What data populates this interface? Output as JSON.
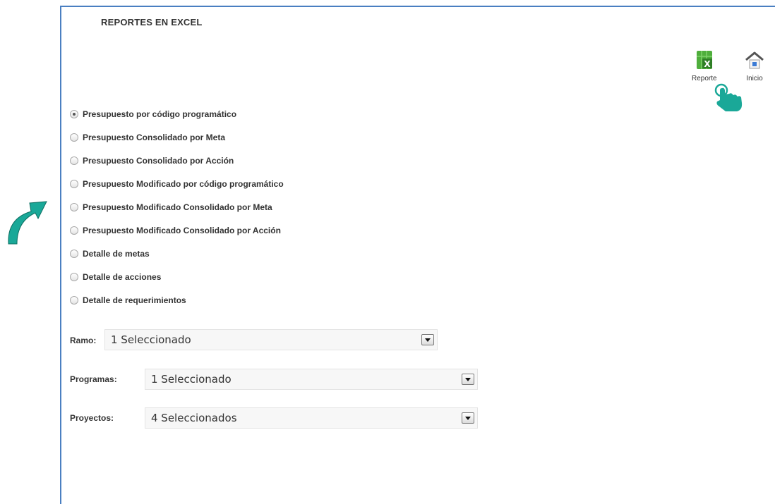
{
  "header": {
    "title": "REPORTES EN EXCEL"
  },
  "toolbar": {
    "reporte": {
      "label": "Reporte",
      "icon": "excel-icon"
    },
    "inicio": {
      "label": "Inicio",
      "icon": "home-icon"
    }
  },
  "report_options": [
    {
      "label": "Presupuesto por código programático",
      "checked": true
    },
    {
      "label": "Presupuesto Consolidado por Meta",
      "checked": false
    },
    {
      "label": "Presupuesto Consolidado por Acción",
      "checked": false
    },
    {
      "label": "Presupuesto Modificado por código programático",
      "checked": false
    },
    {
      "label": "Presupuesto Modificado Consolidado por Meta",
      "checked": false
    },
    {
      "label": "Presupuesto Modificado Consolidado por Acción",
      "checked": false
    },
    {
      "label": "Detalle de metas",
      "checked": false
    },
    {
      "label": "Detalle de acciones",
      "checked": false
    },
    {
      "label": "Detalle de requerimientos",
      "checked": false
    }
  ],
  "filters": {
    "ramo": {
      "label": "Ramo:",
      "value": "1 Seleccionado"
    },
    "programas": {
      "label": "Programas:",
      "value": "1 Seleccionado"
    },
    "proyectos": {
      "label": "Proyectos:",
      "value": "4 Seleccionados"
    }
  },
  "colors": {
    "accent_border": "#4a7fc1",
    "annotation": "#1aa898",
    "excel": "#4fae3c"
  }
}
